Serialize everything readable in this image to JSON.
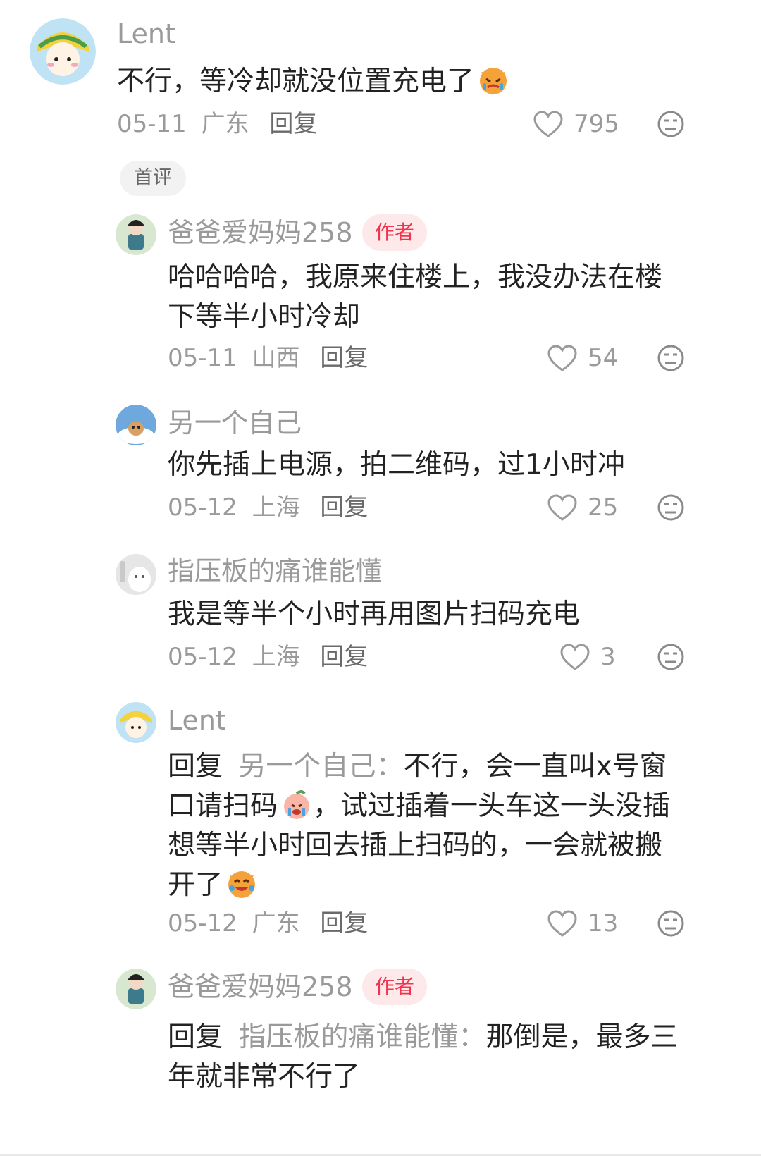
{
  "comments": [
    {
      "user": "Lent",
      "text": "不行，等冷却就没位置充电了",
      "emoji": "cat-crying-emoji",
      "date": "05-11",
      "location": "广东",
      "reply_label": "回复",
      "likes": "795",
      "badge": "首评"
    },
    {
      "user": "爸爸爱妈妈258",
      "author_tag": "作者",
      "text": "哈哈哈哈，我原来住楼上，我没办法在楼下等半小时冷却",
      "date": "05-11",
      "location": "山西",
      "reply_label": "回复",
      "likes": "54"
    },
    {
      "user": "另一个自己",
      "text": "你先插上电源，拍二维码，过1小时冲",
      "date": "05-12",
      "location": "上海",
      "reply_label": "回复",
      "likes": "25"
    },
    {
      "user": "指压板的痛谁能懂",
      "text": "我是等半个小时再用图片扫码充电",
      "date": "05-12",
      "location": "上海",
      "reply_label": "回复",
      "likes": "3"
    },
    {
      "user": "Lent",
      "reply_keyword": "回复",
      "reply_target": "另一个自己：",
      "text_part1": "不行，会一直叫x号窗口请扫码",
      "text_part2": "，试过插着一头车这一头没插想等半小时回去插上扫码的，一会就被搬开了",
      "date": "05-12",
      "location": "广东",
      "reply_label": "回复",
      "likes": "13"
    },
    {
      "user": "爸爸爱妈妈258",
      "author_tag": "作者",
      "reply_keyword": "回复",
      "reply_target": "指压板的痛谁能懂：",
      "text": "那倒是，最多三年就非常不行了"
    }
  ],
  "colors": {
    "secondary_text": "#9a9a9a",
    "author_tag_bg": "#fde8ea",
    "author_tag_fg": "#f0344d"
  }
}
